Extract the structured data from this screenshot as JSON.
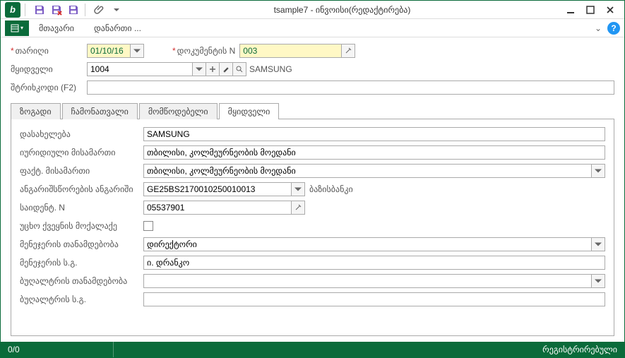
{
  "titlebar": {
    "title": "tsample7 - ინვოისი(რედაქტირება)"
  },
  "menubar": {
    "main": "მთავარი",
    "attach": "დანართი ..."
  },
  "header": {
    "date_label": "თარიღი",
    "date_value": "01/10/16",
    "docnum_label": "დოკუმენტის N",
    "docnum_value": "003",
    "buyer_label": "მყიდველი",
    "buyer_code": "1004",
    "buyer_name": "SAMSUNG",
    "barcode_label": "შტრიხკოდი (F2)",
    "barcode_value": ""
  },
  "tabs": {
    "t1": "ზოგადი",
    "t2": "ჩამონათვალი",
    "t3": "მომწოდებელი",
    "t4": "მყიდველი"
  },
  "buyer": {
    "name_label": "დასახელება",
    "name": "SAMSUNG",
    "legal_label": "იურიდიული მისამართი",
    "legal": "თბილისი, კოლმეურნეობის მოედანი",
    "actual_label": "ფაქტ. მისამართი",
    "actual": "თბილისი, კოლმეურნეობის მოედანი",
    "bank_label": "ანგარიშსწორების ანგარიში",
    "bank_acct": "GE25BS2170010250010013",
    "bank_name": "ბაზისბანკი",
    "taxid_label": "საიდენტ. N",
    "taxid": "05537901",
    "foreign_label": "უცხო ქვეყნის მოქალაქე",
    "mgr_title_label": "მენეჯერის თანამდებობა",
    "mgr_title": "დირექტორი",
    "mgr_name_label": "მენეჯერის ს.გ.",
    "mgr_name": "ი. დრანკო",
    "acc_title_label": "ბუღალტრის თანამდებობა",
    "acc_title": "",
    "acc_name_label": "ბუღალტრის ს.გ.",
    "acc_name": ""
  },
  "status": {
    "left": "0/0",
    "right": "რეგისტრირებული"
  }
}
